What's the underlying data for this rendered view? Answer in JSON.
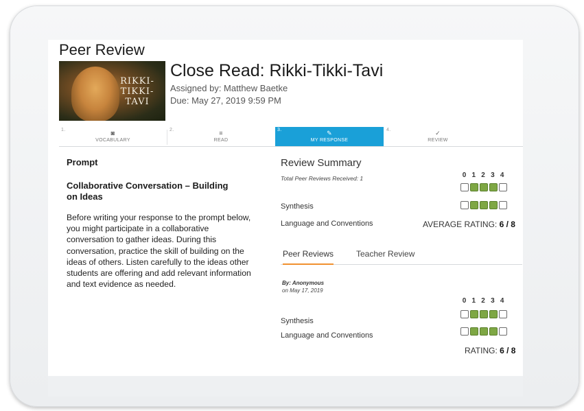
{
  "page": {
    "title": "Peer Review"
  },
  "assignment": {
    "cover_text": "RIKKI-TIKKI-TAVI",
    "title": "Close Read: Rikki-Tikki-Tavi",
    "assigned_by": "Assigned by: Matthew Baetke",
    "due": "Due: May 27, 2019 9:59 PM"
  },
  "tabs": [
    {
      "num": "1.",
      "icon": "camera-icon",
      "glyph": "◙",
      "label": "VOCABULARY",
      "active": false
    },
    {
      "num": "2.",
      "icon": "list-icon",
      "glyph": "≡",
      "label": "READ",
      "active": false
    },
    {
      "num": "3.",
      "icon": "pencil-icon",
      "glyph": "✎",
      "label": "MY RESPONSE",
      "active": true
    },
    {
      "num": "4.",
      "icon": "check-icon",
      "glyph": "✓",
      "label": "REVIEW",
      "active": false
    }
  ],
  "prompt": {
    "heading": "Prompt",
    "title": "Collaborative Conversation – Building on Ideas",
    "body": "Before writing your response to the prompt below, you might participate in a collaborative conversation to gather ideas. During this conversation, practice the skill of building on the ideas of others. Listen carefully to the ideas other students are offering and add relevant information and text evidence as needed."
  },
  "review_summary": {
    "title": "Review Summary",
    "total_received": "Total Peer Reviews Received: 1",
    "scale": [
      "0",
      "1",
      "2",
      "3",
      "4"
    ],
    "criteria": [
      {
        "label": "Synthesis",
        "rating": 3
      },
      {
        "label": "Language and Conventions",
        "rating": 3
      }
    ],
    "average_label": "AVERAGE RATING:",
    "average_value": "6 / 8"
  },
  "review_tabs": {
    "peer": "Peer Reviews",
    "teacher": "Teacher Review"
  },
  "peer_review": {
    "by": "By: Anonymous",
    "date": "on May 17, 2019",
    "scale": [
      "0",
      "1",
      "2",
      "3",
      "4"
    ],
    "criteria": [
      {
        "label": "Synthesis",
        "rating": 3
      },
      {
        "label": "Language and Conventions",
        "rating": 3
      }
    ],
    "rating_label": "RATING:",
    "rating_value": "6 / 8"
  },
  "colors": {
    "active_tab": "#1aa0d8",
    "rating_fill": "#7ea744",
    "subtab_underline": "#f0902e"
  }
}
